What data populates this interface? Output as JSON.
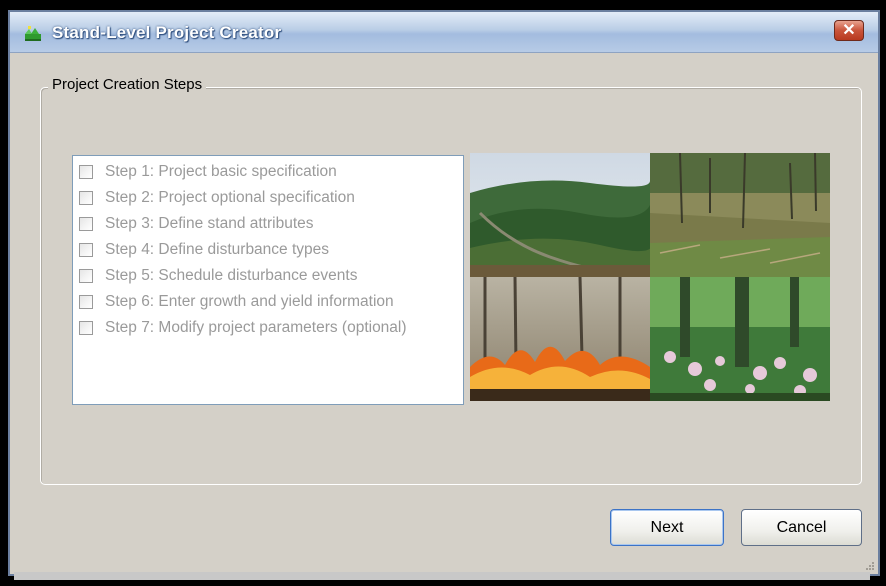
{
  "window": {
    "title": "Stand-Level Project Creator",
    "close_icon": "close-icon"
  },
  "group": {
    "title": "Project Creation Steps"
  },
  "steps": [
    {
      "label": "Step 1: Project basic specification",
      "checked": false
    },
    {
      "label": "Step 2: Project optional specification",
      "checked": false
    },
    {
      "label": "Step 3: Define stand attributes",
      "checked": false
    },
    {
      "label": "Step 4: Define disturbance types",
      "checked": false
    },
    {
      "label": "Step 5: Schedule disturbance events",
      "checked": false
    },
    {
      "label": "Step 6: Enter growth and yield information",
      "checked": false
    },
    {
      "label": "Step 7: Modify project parameters (optional)",
      "checked": false
    }
  ],
  "photos": [
    "green-hills-image",
    "clearcut-forest-image",
    "forest-fire-image",
    "flowering-forest-image"
  ],
  "buttons": {
    "next_label": "Next",
    "cancel_label": "Cancel"
  },
  "colors": {
    "window_bg": "#d4d0c8",
    "title_text": "#ffffff",
    "disabled_text": "#9a9a9a",
    "close_red": "#c9543a"
  }
}
